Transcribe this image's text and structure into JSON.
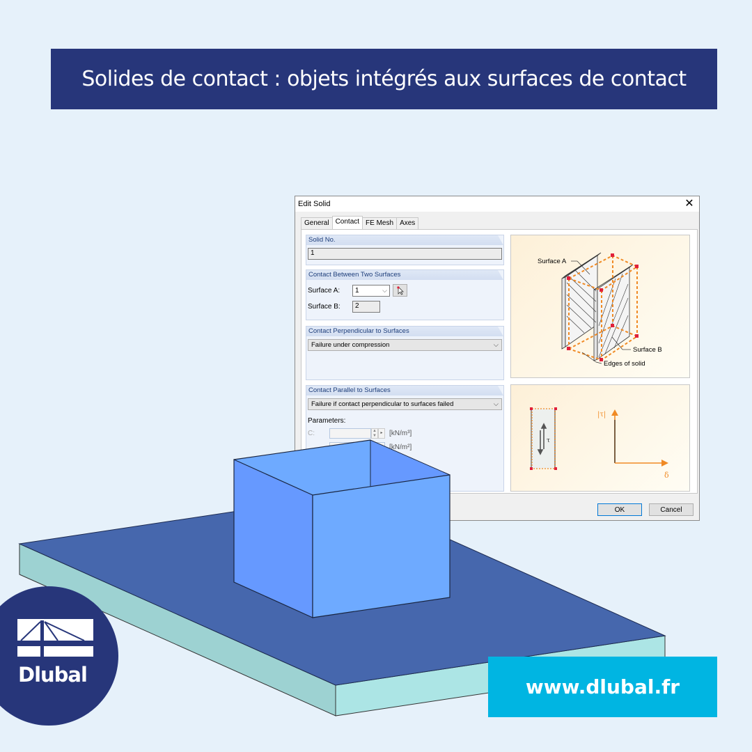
{
  "banner": {
    "title": "Solides de contact : objets intégrés aux surfaces de contact"
  },
  "dialog": {
    "title": "Edit Solid",
    "close_icon": "close-icon",
    "tabs": [
      {
        "label": "General",
        "active": false
      },
      {
        "label": "Contact",
        "active": true
      },
      {
        "label": "FE Mesh",
        "active": false
      },
      {
        "label": "Axes",
        "active": false
      }
    ],
    "solid_no": {
      "header": "Solid No.",
      "value": "1"
    },
    "contact_between": {
      "header": "Contact Between Two Surfaces",
      "surface_a_label": "Surface A:",
      "surface_a_value": "1",
      "surface_b_label": "Surface B:",
      "surface_b_value": "2",
      "pick_icon": "pick-surface-icon"
    },
    "perpendicular": {
      "header": "Contact Perpendicular to Surfaces",
      "value": "Failure under compression"
    },
    "parallel": {
      "header": "Contact Parallel to Surfaces",
      "value": "Failure if contact perpendicular to surfaces failed",
      "parameters_label": "Parameters:",
      "param_c_label": "C:",
      "param_c_unit": "[kN/m³]",
      "param_2_unit": "[kN/m²]"
    },
    "diagram1": {
      "surface_a": "Surface A",
      "surface_b": "Surface B",
      "edges": "Edges of solid"
    },
    "diagram2": {
      "y_axis": "|τ|",
      "x_axis": "δ",
      "tau": "τ"
    },
    "ok_label": "OK",
    "cancel_label": "Cancel"
  },
  "logo": {
    "text": "Dlubal"
  },
  "url": {
    "text": "www.dlubal.fr"
  },
  "colors": {
    "brand_navy": "#27367a",
    "brand_cyan": "#00b5e2",
    "slab_top": "#4667ad",
    "slab_side": "#a8e3e3",
    "box_face_left": "#6699ff",
    "box_face_right": "#6eaaff",
    "accent_orange": "#f08a24"
  }
}
